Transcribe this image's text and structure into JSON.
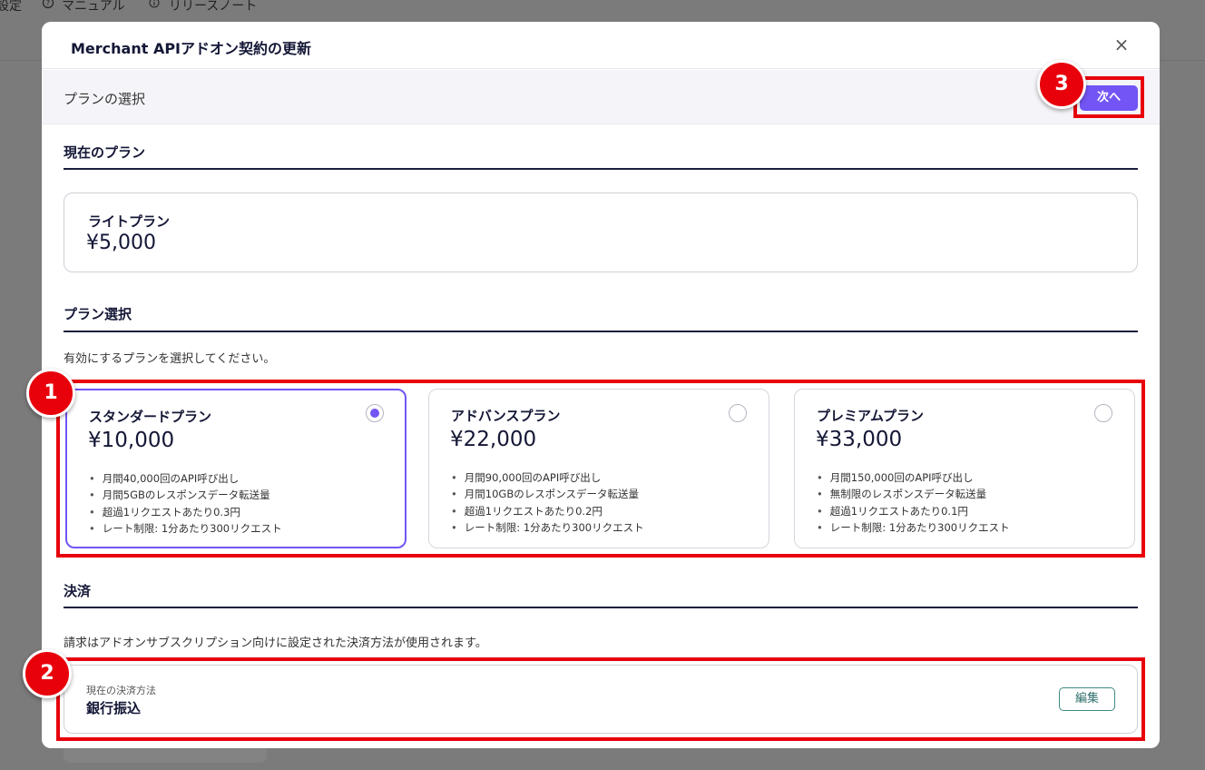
{
  "background": {
    "nav": [
      {
        "label": "設定"
      },
      {
        "icon": "help-circle-icon",
        "label": "マニュアル"
      },
      {
        "icon": "info-icon",
        "label": "リリースノート"
      }
    ]
  },
  "modal": {
    "title": "Merchant APIアドオン契約の更新",
    "close_icon": "×",
    "step_label": "プランの選択",
    "next_label": "次へ"
  },
  "current_plan": {
    "heading": "現在のプラン",
    "name": "ライトプラン",
    "price": "¥5,000"
  },
  "plan_selection": {
    "heading": "プラン選択",
    "description": "有効にするプランを選択してください。",
    "plans": [
      {
        "name": "スタンダードプラン",
        "price": "¥10,000",
        "selected": true,
        "features": [
          "月間40,000回のAPI呼び出し",
          "月間5GBのレスポンスデータ転送量",
          "超過1リクエストあたり0.3円",
          "レート制限: 1分あたり300リクエスト"
        ]
      },
      {
        "name": "アドバンスプラン",
        "price": "¥22,000",
        "selected": false,
        "features": [
          "月間90,000回のAPI呼び出し",
          "月間10GBのレスポンスデータ転送量",
          "超過1リクエストあたり0.2円",
          "レート制限: 1分あたり300リクエスト"
        ]
      },
      {
        "name": "プレミアムプラン",
        "price": "¥33,000",
        "selected": false,
        "features": [
          "月間150,000回のAPI呼び出し",
          "無制限のレスポンスデータ転送量",
          "超過1リクエストあたり0.1円",
          "レート制限: 1分あたり300リクエスト"
        ]
      }
    ]
  },
  "payment": {
    "heading": "決済",
    "description": "請求はアドオンサブスクリプション向けに設定された決済方法が使用されます。",
    "current_label": "現在の決済方法",
    "method": "銀行振込",
    "edit_label": "編集"
  },
  "annotations": {
    "color": "#e8000b",
    "badges": [
      "1",
      "2",
      "3"
    ]
  },
  "colors": {
    "accent": "#7355f5",
    "edit_border": "#3f8b86"
  }
}
